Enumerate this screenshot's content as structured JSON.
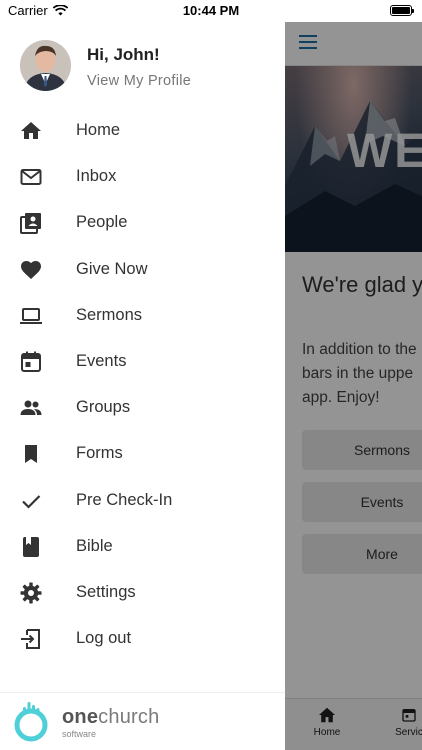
{
  "status_bar": {
    "carrier": "Carrier",
    "time": "10:44 PM"
  },
  "profile": {
    "greeting": "Hi, John!",
    "link": "View My Profile"
  },
  "menu": [
    {
      "label": "Home",
      "icon": "home-icon"
    },
    {
      "label": "Inbox",
      "icon": "mail-icon"
    },
    {
      "label": "People",
      "icon": "people-directory-icon"
    },
    {
      "label": "Give Now",
      "icon": "heart-icon"
    },
    {
      "label": "Sermons",
      "icon": "laptop-icon"
    },
    {
      "label": "Events",
      "icon": "calendar-icon"
    },
    {
      "label": "Groups",
      "icon": "group-icon"
    },
    {
      "label": "Forms",
      "icon": "bookmark-icon"
    },
    {
      "label": "Pre Check-In",
      "icon": "checkmark-icon"
    },
    {
      "label": "Bible",
      "icon": "book-icon"
    },
    {
      "label": "Settings",
      "icon": "gear-icon"
    },
    {
      "label": "Log out",
      "icon": "logout-icon"
    }
  ],
  "footer": {
    "brand_light": "one",
    "brand_bold": "church",
    "brand_sub": "software"
  },
  "main": {
    "hero_text": "WE",
    "title": "We're glad y",
    "body_lines": [
      "In addition to the",
      "bars in the uppe",
      "app. Enjoy!"
    ],
    "buttons": [
      "Sermons",
      "Events",
      "More"
    ],
    "tabs": [
      "Home",
      "Servic"
    ]
  },
  "colors": {
    "accent": "#1e6fa8",
    "logo_teal": "#4fd0d8"
  }
}
